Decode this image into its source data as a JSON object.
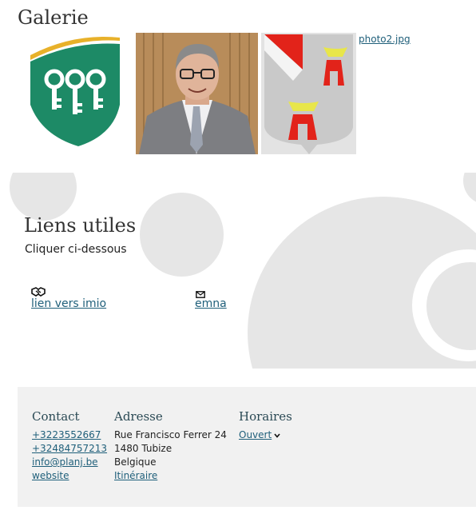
{
  "gallery": {
    "title": "Galerie",
    "file_link": "photo2.jpg"
  },
  "links": {
    "title": "Liens utiles",
    "subtitle": "Cliquer ci-dessous",
    "items": [
      {
        "label": "lien vers imio",
        "icon": "handshake-icon"
      },
      {
        "label": "emna",
        "icon": "envelope-icon"
      }
    ]
  },
  "footer": {
    "contact": {
      "heading": "Contact",
      "phone1": "+3223552667",
      "phone2": "+32484757213",
      "email": "info@planj.be",
      "website": "website"
    },
    "address": {
      "heading": "Adresse",
      "street": "Rue Francisco Ferrer 24",
      "city": "1480 Tubize",
      "country": "Belgique",
      "route_link": "Itinéraire"
    },
    "hours": {
      "heading": "Horaires",
      "status": "Ouvert"
    }
  },
  "colors": {
    "link": "#1f5f7a",
    "heading": "#2b4a55",
    "footer_bg": "#f1f1f1",
    "decor_circle": "#e6e6e6",
    "logo_green": "#1d8a66",
    "logo_gold": "#e8b12a",
    "crest_red": "#e2231a"
  }
}
